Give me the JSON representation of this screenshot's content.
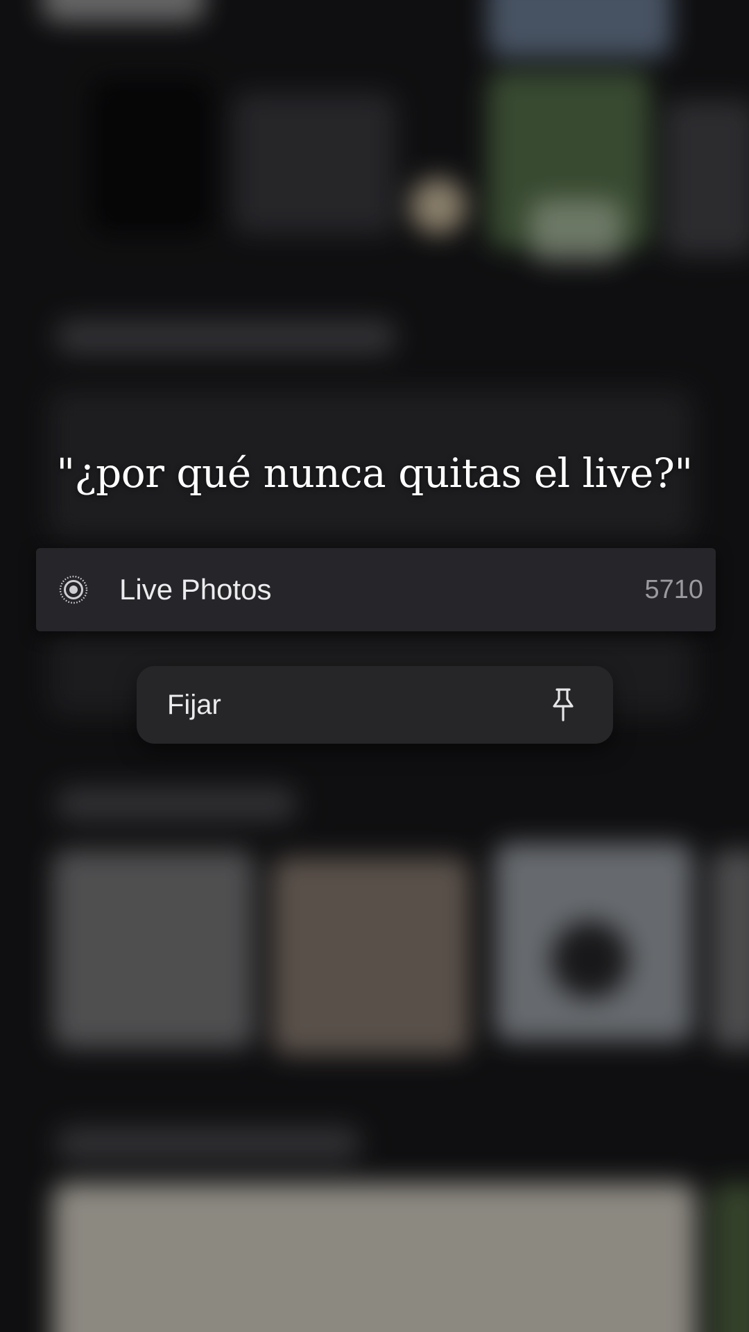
{
  "caption": {
    "text": "\"¿por qué nunca quitas el live?\""
  },
  "album_row": {
    "icon": "live-photo-icon",
    "label": "Live Photos",
    "count": "5710"
  },
  "context_menu": {
    "items": [
      {
        "label": "Fijar",
        "icon": "pin-icon"
      }
    ]
  },
  "theme": {
    "background": "#111113",
    "row_background": "#26262a",
    "menu_background": "#262629",
    "text_primary": "#ececee",
    "text_secondary": "#9a9aa0"
  }
}
